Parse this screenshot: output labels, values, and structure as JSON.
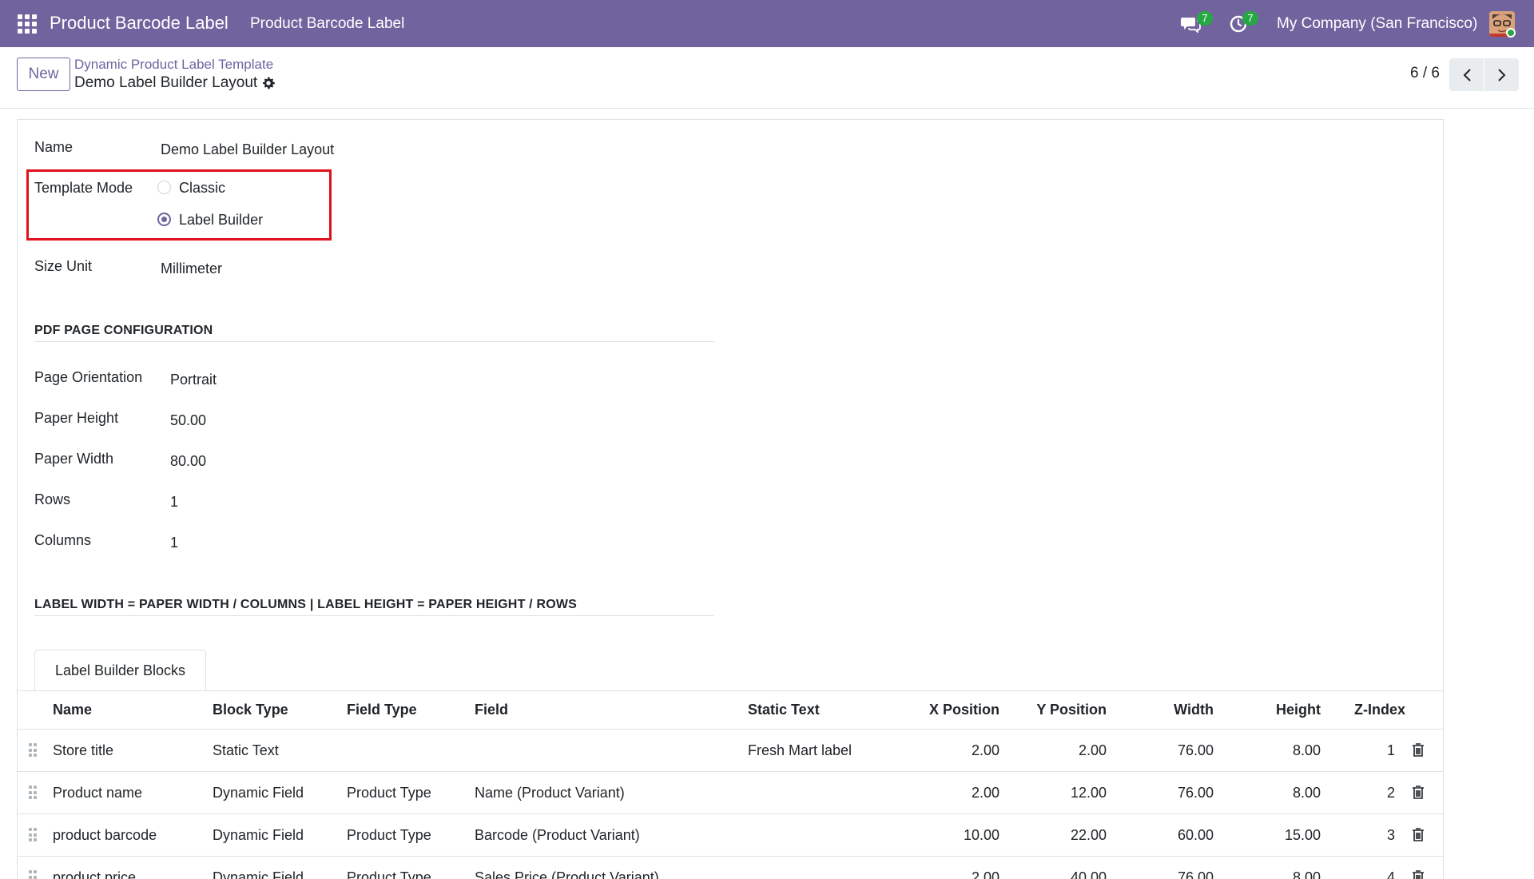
{
  "navbar": {
    "app_name": "Product Barcode Label",
    "menu": "Product Barcode Label",
    "messages_count": "7",
    "activities_count": "7",
    "company": "My Company (San Francisco)"
  },
  "control_panel": {
    "new_label": "New",
    "breadcrumb_parent": "Dynamic Product Label Template",
    "breadcrumb_current": "Demo Label Builder Layout",
    "pager": "6 / 6"
  },
  "form": {
    "name_label": "Name",
    "name_value": "Demo Label Builder Layout",
    "template_mode_label": "Template Mode",
    "template_mode_options": [
      "Classic",
      "Label Builder"
    ],
    "template_mode_selected": "Label Builder",
    "size_unit_label": "Size Unit",
    "size_unit_value": "Millimeter",
    "pdf_section_title": "PDF PAGE CONFIGURATION",
    "page_orientation_label": "Page Orientation",
    "page_orientation_value": "Portrait",
    "paper_height_label": "Paper Height",
    "paper_height_value": "50.00",
    "paper_width_label": "Paper Width",
    "paper_width_value": "80.00",
    "rows_label": "Rows",
    "rows_value": "1",
    "columns_label": "Columns",
    "columns_value": "1",
    "label_size_section_title": "LABEL WIDTH = PAPER WIDTH / COLUMNS | LABEL HEIGHT = PAPER HEIGHT / ROWS"
  },
  "notebook": {
    "tab_label": "Label Builder Blocks"
  },
  "table": {
    "headers": [
      "Name",
      "Block Type",
      "Field Type",
      "Field",
      "Static Text",
      "X Position",
      "Y Position",
      "Width",
      "Height",
      "Z-Index"
    ],
    "rows": [
      {
        "name": "Store title",
        "block_type": "Static Text",
        "field_type": "",
        "field": "",
        "static_text": "Fresh Mart label",
        "x": "2.00",
        "y": "2.00",
        "width": "76.00",
        "height": "8.00",
        "z": "1"
      },
      {
        "name": "Product name",
        "block_type": "Dynamic Field",
        "field_type": "Product Type",
        "field": "Name (Product Variant)",
        "static_text": "",
        "x": "2.00",
        "y": "12.00",
        "width": "76.00",
        "height": "8.00",
        "z": "2"
      },
      {
        "name": "product barcode",
        "block_type": "Dynamic Field",
        "field_type": "Product Type",
        "field": "Barcode (Product Variant)",
        "static_text": "",
        "x": "10.00",
        "y": "22.00",
        "width": "60.00",
        "height": "15.00",
        "z": "3"
      },
      {
        "name": "product price",
        "block_type": "Dynamic Field",
        "field_type": "Product Type",
        "field": "Sales Price (Product Variant)",
        "static_text": "",
        "x": "2.00",
        "y": "40.00",
        "width": "76.00",
        "height": "8.00",
        "z": "4"
      }
    ]
  },
  "colors": {
    "brand": "#71639e",
    "badge": "#28a745",
    "highlight": "#e0101e"
  }
}
